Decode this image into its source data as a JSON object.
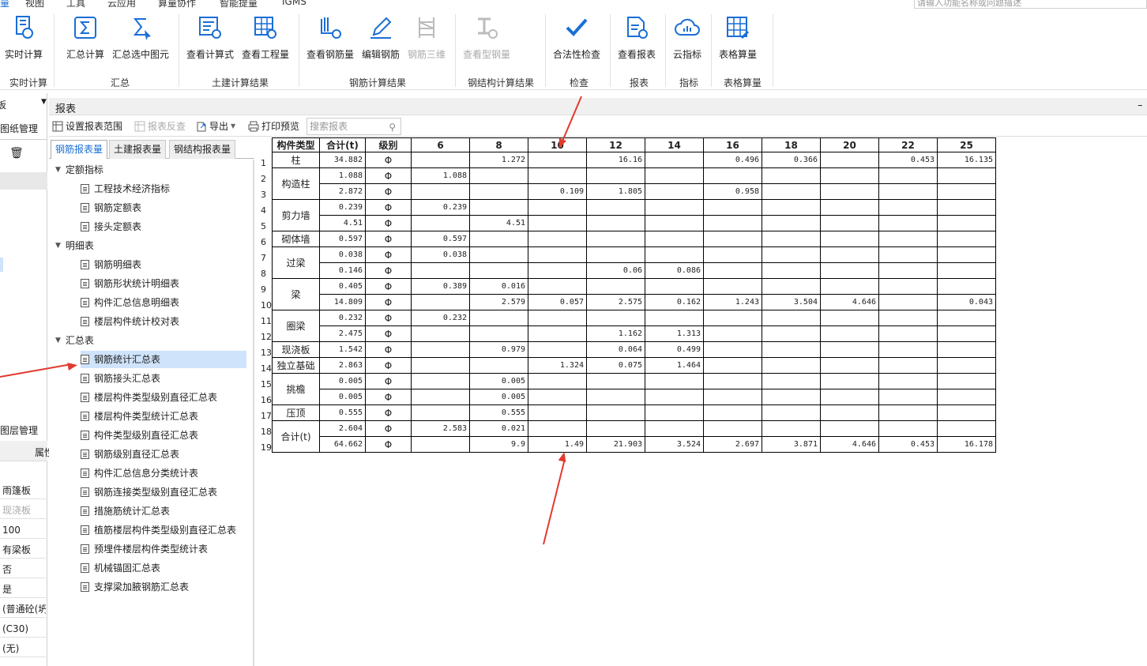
{
  "menubar": {
    "items": [
      "量",
      "视图",
      "工具",
      "云应用",
      "算量协作",
      "智能提量",
      "IGMS"
    ],
    "search_placeholder": "请输入功能名称或问题描述"
  },
  "ribbon": {
    "buttons": [
      {
        "label": "实时计算",
        "icon": "realtime-calc-icon"
      },
      {
        "label": "汇总计算",
        "icon": "sum-calc-icon"
      },
      {
        "label": "汇总选中图元",
        "icon": "sum-selected-icon"
      },
      {
        "label": "查看计算式",
        "icon": "view-formula-icon"
      },
      {
        "label": "查看工程量",
        "icon": "view-quantity-icon"
      },
      {
        "label": "查看钢筋量",
        "icon": "view-rebar-icon"
      },
      {
        "label": "编辑钢筋",
        "icon": "edit-rebar-icon"
      },
      {
        "label": "钢筋三维",
        "icon": "rebar-3d-icon"
      },
      {
        "label": "查看型钢量",
        "icon": "view-steel-icon"
      },
      {
        "label": "合法性检查",
        "icon": "check-icon"
      },
      {
        "label": "查看报表",
        "icon": "view-report-icon"
      },
      {
        "label": "云指标",
        "icon": "cloud-index-icon"
      },
      {
        "label": "表格算量",
        "icon": "table-calc-icon"
      }
    ],
    "groups": [
      "实时计算",
      "汇总",
      "土建计算结果",
      "钢筋计算结果",
      "钢结构计算结果",
      "检查",
      "报表",
      "指标",
      "表格算量"
    ]
  },
  "left_strip": {
    "top_label": "板",
    "drawing_mgmt": "图纸管理",
    "layer_mgmt": "图层管理",
    "col_header": "属性",
    "values": [
      "雨篷板",
      "现浇板",
      "100",
      "有梁板",
      "否",
      "是",
      "(普通砼(坍",
      "(C30)",
      "(无)"
    ]
  },
  "panel": {
    "title": "报表",
    "toolbar": {
      "set_range": "设置报表范围",
      "reverse": "报表反查",
      "export": "导出",
      "print": "打印预览",
      "search_placeholder": "搜索报表"
    },
    "tabs": [
      "钢筋报表量",
      "土建报表量",
      "钢结构报表量"
    ]
  },
  "tree": {
    "categories": [
      {
        "name": "定额指标",
        "items": [
          "工程技术经济指标",
          "钢筋定额表",
          "接头定额表"
        ]
      },
      {
        "name": "明细表",
        "items": [
          "钢筋明细表",
          "钢筋形状统计明细表",
          "构件汇总信息明细表",
          "楼层构件统计校对表"
        ]
      },
      {
        "name": "汇总表",
        "items": [
          "钢筋统计汇总表",
          "钢筋接头汇总表",
          "楼层构件类型级别直径汇总表",
          "楼层构件类型统计汇总表",
          "构件类型级别直径汇总表",
          "钢筋级别直径汇总表",
          "构件汇总信息分类统计表",
          "钢筋连接类型级别直径汇总表",
          "措施筋统计汇总表",
          "植筋楼层构件类型级别直径汇总表",
          "预埋件楼层构件类型统计表",
          "机械锚固汇总表",
          "支撑梁加腋钢筋汇总表"
        ]
      }
    ],
    "selected": "钢筋统计汇总表"
  },
  "report": {
    "headers": [
      "构件类型",
      "合计(t)",
      "级别",
      "6",
      "8",
      "10",
      "12",
      "14",
      "16",
      "18",
      "20",
      "22",
      "25"
    ],
    "rows": [
      {
        "n": "1",
        "type": "柱",
        "span": 1,
        "total": "34.882",
        "grade": "Φ",
        "v": [
          "",
          "1.272",
          "",
          "16.16",
          "",
          "0.496",
          "0.366",
          "",
          "0.453",
          "16.135"
        ]
      },
      {
        "n": "2",
        "type": "构造柱",
        "span": 2,
        "total": "1.088",
        "grade": "Φ",
        "v": [
          "1.088",
          "",
          "",
          "",
          "",
          "",
          "",
          "",
          "",
          ""
        ]
      },
      {
        "n": "3",
        "type": "",
        "span": 0,
        "total": "2.872",
        "grade": "Φ",
        "v": [
          "",
          "",
          "0.109",
          "1.805",
          "",
          "0.958",
          "",
          "",
          "",
          ""
        ]
      },
      {
        "n": "4",
        "type": "剪力墙",
        "span": 2,
        "total": "0.239",
        "grade": "Φ",
        "v": [
          "0.239",
          "",
          "",
          "",
          "",
          "",
          "",
          "",
          "",
          ""
        ]
      },
      {
        "n": "5",
        "type": "",
        "span": 0,
        "total": "4.51",
        "grade": "Φ",
        "v": [
          "",
          "4.51",
          "",
          "",
          "",
          "",
          "",
          "",
          "",
          ""
        ]
      },
      {
        "n": "6",
        "type": "砌体墙",
        "span": 1,
        "total": "0.597",
        "grade": "Φ",
        "v": [
          "0.597",
          "",
          "",
          "",
          "",
          "",
          "",
          "",
          "",
          ""
        ]
      },
      {
        "n": "7",
        "type": "过梁",
        "span": 2,
        "total": "0.038",
        "grade": "Φ",
        "v": [
          "0.038",
          "",
          "",
          "",
          "",
          "",
          "",
          "",
          "",
          ""
        ]
      },
      {
        "n": "8",
        "type": "",
        "span": 0,
        "total": "0.146",
        "grade": "Φ",
        "v": [
          "",
          "",
          "",
          "0.06",
          "0.086",
          "",
          "",
          "",
          "",
          ""
        ]
      },
      {
        "n": "9",
        "type": "梁",
        "span": 2,
        "total": "0.405",
        "grade": "Φ",
        "v": [
          "0.389",
          "0.016",
          "",
          "",
          "",
          "",
          "",
          "",
          "",
          ""
        ]
      },
      {
        "n": "10",
        "type": "",
        "span": 0,
        "total": "14.809",
        "grade": "Φ",
        "v": [
          "",
          "2.579",
          "0.057",
          "2.575",
          "0.162",
          "1.243",
          "3.504",
          "4.646",
          "",
          "0.043"
        ]
      },
      {
        "n": "11",
        "type": "圈梁",
        "span": 2,
        "total": "0.232",
        "grade": "Φ",
        "v": [
          "0.232",
          "",
          "",
          "",
          "",
          "",
          "",
          "",
          "",
          ""
        ]
      },
      {
        "n": "12",
        "type": "",
        "span": 0,
        "total": "2.475",
        "grade": "Φ",
        "v": [
          "",
          "",
          "",
          "1.162",
          "1.313",
          "",
          "",
          "",
          "",
          ""
        ]
      },
      {
        "n": "13",
        "type": "现浇板",
        "span": 1,
        "total": "1.542",
        "grade": "Φ",
        "v": [
          "",
          "0.979",
          "",
          "0.064",
          "0.499",
          "",
          "",
          "",
          "",
          ""
        ]
      },
      {
        "n": "14",
        "type": "独立基础",
        "span": 1,
        "total": "2.863",
        "grade": "Φ",
        "v": [
          "",
          "",
          "1.324",
          "0.075",
          "1.464",
          "",
          "",
          "",
          "",
          ""
        ]
      },
      {
        "n": "15",
        "type": "挑檐",
        "span": 2,
        "total": "0.005",
        "grade": "Φ",
        "v": [
          "",
          "0.005",
          "",
          "",
          "",
          "",
          "",
          "",
          "",
          ""
        ]
      },
      {
        "n": "16",
        "type": "",
        "span": 0,
        "total": "0.005",
        "grade": "Φ",
        "v": [
          "",
          "0.005",
          "",
          "",
          "",
          "",
          "",
          "",
          "",
          ""
        ]
      },
      {
        "n": "17",
        "type": "压顶",
        "span": 1,
        "total": "0.555",
        "grade": "Φ",
        "v": [
          "",
          "0.555",
          "",
          "",
          "",
          "",
          "",
          "",
          "",
          ""
        ]
      },
      {
        "n": "18",
        "type": "合计(t)",
        "span": 2,
        "total": "2.604",
        "grade": "Φ",
        "v": [
          "2.583",
          "0.021",
          "",
          "",
          "",
          "",
          "",
          "",
          "",
          ""
        ]
      },
      {
        "n": "19",
        "type": "",
        "span": 0,
        "total": "64.662",
        "grade": "Φ",
        "v": [
          "",
          "9.9",
          "1.49",
          "21.903",
          "3.524",
          "2.697",
          "3.871",
          "4.646",
          "0.453",
          "16.178"
        ]
      }
    ]
  },
  "colors": {
    "accent": "#1a6fd6",
    "annotation_arrow": "#e23a2e",
    "selection": "#cfe3fb"
  }
}
